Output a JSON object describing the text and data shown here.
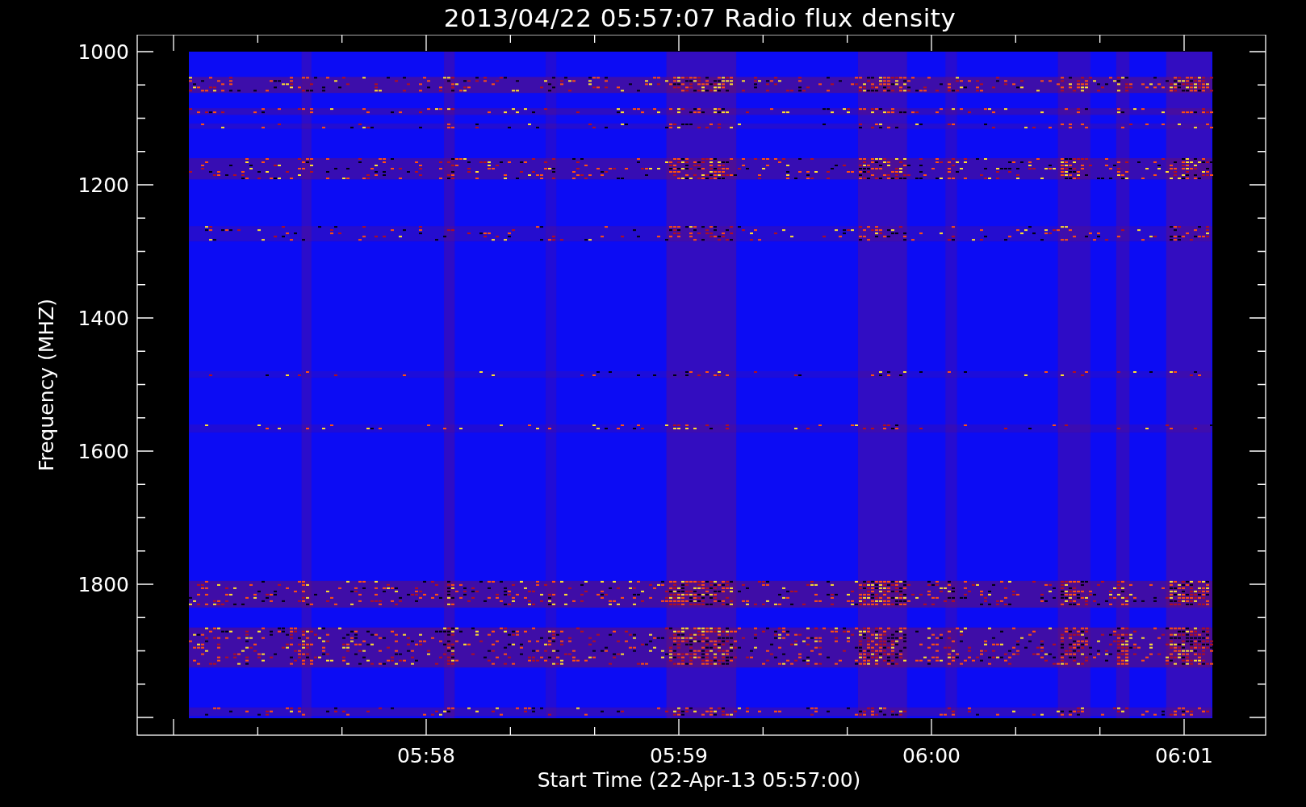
{
  "title": "2013/04/22 05:57:07 Radio flux density",
  "chart": {
    "xlabel": "Start Time (22-Apr-13 05:57:00)",
    "ylabel": "Frequency (MHZ)",
    "yticks": [
      {
        "label": "1000"
      },
      {
        "label": "1200"
      },
      {
        "label": "1400"
      },
      {
        "label": "1600"
      },
      {
        "label": "1800"
      }
    ],
    "xticks": [
      {
        "label": "05:58"
      },
      {
        "label": "05:59"
      },
      {
        "label": "06:00"
      },
      {
        "label": "06:01"
      }
    ]
  }
}
